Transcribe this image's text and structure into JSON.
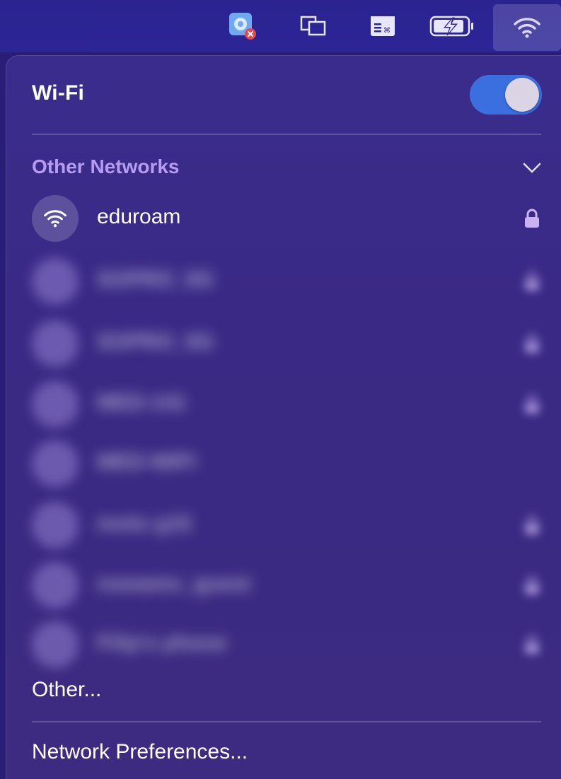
{
  "menubar": {
    "icons": [
      "app-status-icon",
      "windows-icon",
      "keyboard-shortcuts-icon",
      "battery-charging-icon",
      "wifi-icon"
    ]
  },
  "wifi": {
    "title": "Wi-Fi",
    "enabled": true
  },
  "other_networks": {
    "header": "Other Networks",
    "expanded": true,
    "networks": [
      {
        "name": "eduroam",
        "secured": true,
        "blurred": false
      },
      {
        "name": "SOPRO_5G",
        "secured": true,
        "blurred": true
      },
      {
        "name": "SOPRO_5G",
        "secured": true,
        "blurred": true
      },
      {
        "name": "MED-141",
        "secured": true,
        "blurred": true
      },
      {
        "name": "MED-WIFI",
        "secured": false,
        "blurred": true
      },
      {
        "name": "moto g15",
        "secured": true,
        "blurred": true
      },
      {
        "name": "nowams_guest",
        "secured": true,
        "blurred": true
      },
      {
        "name": "Filip's phone",
        "secured": true,
        "blurred": true
      }
    ]
  },
  "menu": {
    "other": "Other...",
    "preferences": "Network Preferences..."
  },
  "colors": {
    "accent_purple": "#b79cf3",
    "toggle_on": "#3b6fe0",
    "panel_bg": "#3a2c8c"
  }
}
